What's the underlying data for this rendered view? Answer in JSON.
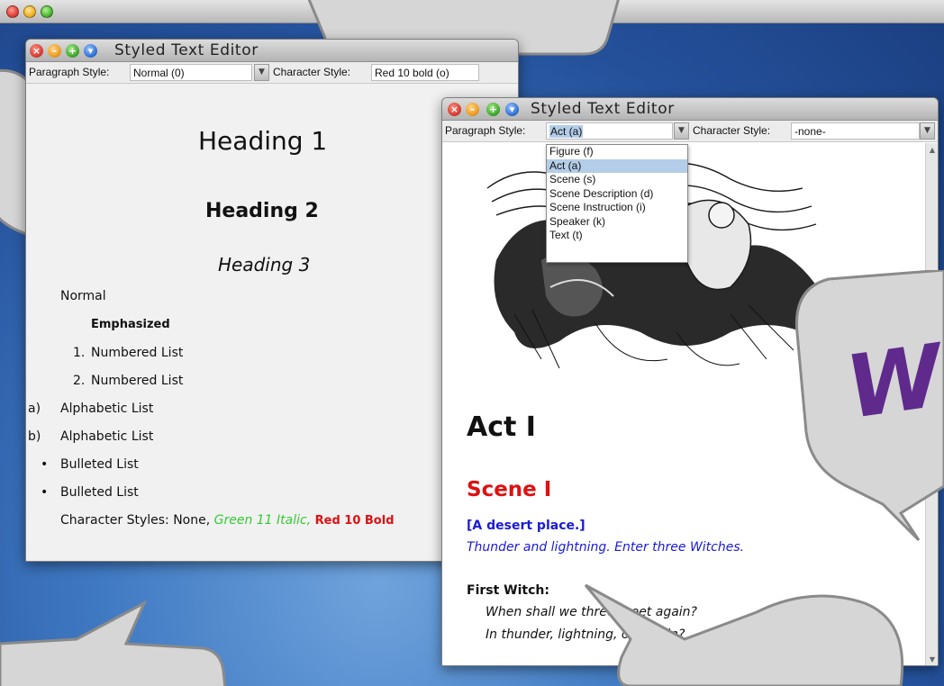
{
  "windows": [
    {
      "title": "Styled Text Editor",
      "paragraph_style_label": "Paragraph Style:",
      "paragraph_style_value": "Normal (0)",
      "character_style_label": "Character Style:",
      "character_style_value": "Red 10 bold (o)",
      "document": {
        "heading1": "Heading 1",
        "heading2": "Heading 2",
        "heading3": "Heading 3",
        "normal": "Normal",
        "emphasized": "Emphasized",
        "numbered": [
          {
            "marker": "1.",
            "text": "Numbered List"
          },
          {
            "marker": "2.",
            "text": "Numbered List"
          }
        ],
        "alphabetic": [
          {
            "marker": "a)",
            "text": "Alphabetic List"
          },
          {
            "marker": "b)",
            "text": "Alphabetic List"
          }
        ],
        "bulleted": [
          {
            "marker": "•",
            "text": "Bulleted List"
          },
          {
            "marker": "•",
            "text": "Bulleted List"
          }
        ],
        "char_styles_prefix": "Character Styles: None,",
        "char_style_green": "Green 11 Italic,",
        "char_style_red": "Red 10 Bold"
      }
    },
    {
      "title": "Styled Text Editor",
      "paragraph_style_label": "Paragraph Style:",
      "paragraph_style_value": "Act (a)",
      "character_style_label": "Character Style:",
      "character_style_value": "-none-",
      "dropdown_options": [
        "Figure (f)",
        "Act (a)",
        "Scene (s)",
        "Scene Description (d)",
        "Scene Instruction (i)",
        "Speaker (k)",
        "Text (t)"
      ],
      "dropdown_selected": "Act (a)",
      "document": {
        "act": "Act I",
        "scene": "Scene I",
        "scene_description": "[A desert place.]",
        "scene_instruction": "Thunder and lightning. Enter three Witches.",
        "speaker": "First Witch:",
        "lines": [
          "When shall we three meet again?",
          "In thunder, lightning, or in rain?"
        ]
      }
    }
  ],
  "decor": {
    "wp_letters": "W"
  }
}
